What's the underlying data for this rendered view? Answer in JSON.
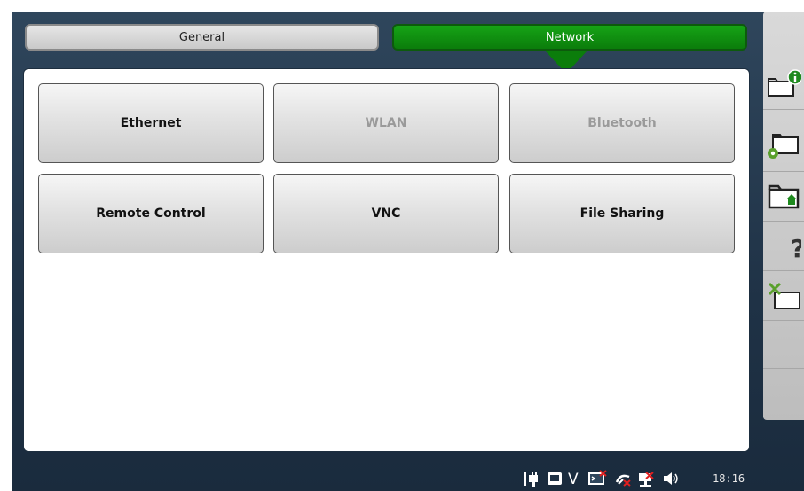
{
  "tabs": [
    {
      "label": "General",
      "active": false
    },
    {
      "label": "Network",
      "active": true
    }
  ],
  "tiles": [
    {
      "label": "Ethernet",
      "enabled": true
    },
    {
      "label": "WLAN",
      "enabled": false
    },
    {
      "label": "Bluetooth",
      "enabled": false
    },
    {
      "label": "Remote Control",
      "enabled": true
    },
    {
      "label": "VNC",
      "enabled": true
    },
    {
      "label": "File Sharing",
      "enabled": true
    }
  ],
  "sidebar": {
    "items": [
      "info-folder-icon",
      "settings-folder-icon",
      "home-folder-icon",
      "help-icon",
      "tools-folder-icon"
    ]
  },
  "statusbar": {
    "icons": [
      "power-plug-icon",
      "storage-icon",
      "vnc-v-icon",
      "remote-terminal-icon",
      "satellite-icon",
      "network-disconnected-icon",
      "speaker-icon"
    ],
    "vnc_glyph": "V",
    "clock": "18:16"
  },
  "colors": {
    "active_tab": "#0b7d0b",
    "background": "#1f3246",
    "disabled_text": "#9a9a9a"
  }
}
